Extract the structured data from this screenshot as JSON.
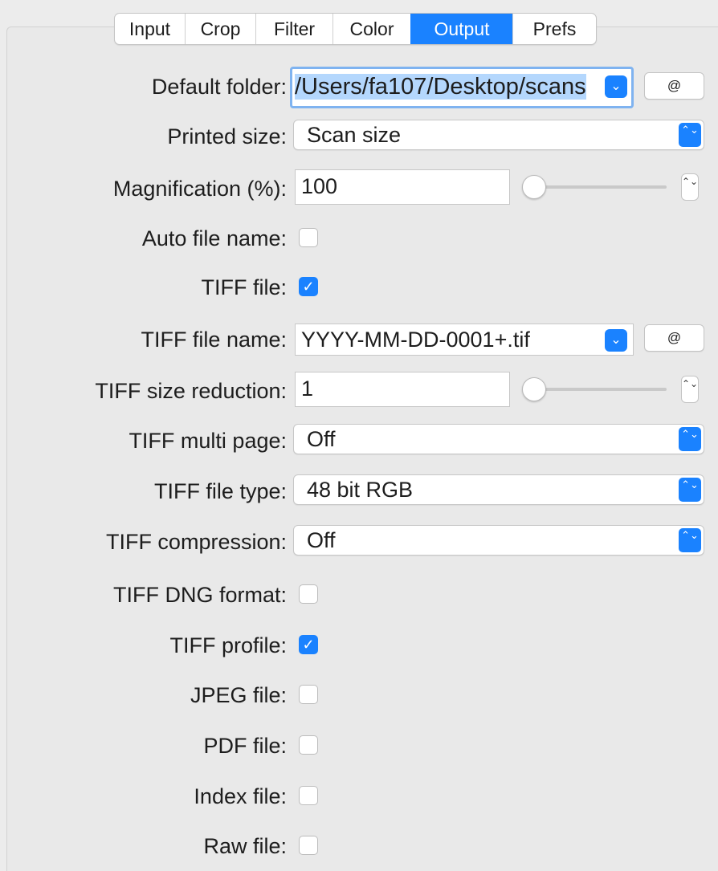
{
  "tabs": [
    {
      "label": "Input",
      "active": false
    },
    {
      "label": "Crop",
      "active": false
    },
    {
      "label": "Filter",
      "active": false
    },
    {
      "label": "Color",
      "active": false
    },
    {
      "label": "Output",
      "active": true
    },
    {
      "label": "Prefs",
      "active": false
    }
  ],
  "default_folder": {
    "label": "Default folder:",
    "value": "/Users/fa107/Desktop/scans",
    "at_label": "@"
  },
  "printed_size": {
    "label": "Printed size:",
    "value": "Scan size"
  },
  "magnification": {
    "label": "Magnification (%):",
    "value": "100"
  },
  "auto_file_name": {
    "label": "Auto file name:",
    "checked": false
  },
  "tiff_file": {
    "label": "TIFF file:",
    "checked": true
  },
  "tiff_file_name": {
    "label": "TIFF file name:",
    "value": "YYYY-MM-DD-0001+.tif",
    "at_label": "@"
  },
  "tiff_size_reduction": {
    "label": "TIFF size reduction:",
    "value": "1"
  },
  "tiff_multi_page": {
    "label": "TIFF multi page:",
    "value": "Off"
  },
  "tiff_file_type": {
    "label": "TIFF file type:",
    "value": "48 bit RGB"
  },
  "tiff_compression": {
    "label": "TIFF compression:",
    "value": "Off"
  },
  "tiff_dng_format": {
    "label": "TIFF DNG format:",
    "checked": false
  },
  "tiff_profile": {
    "label": "TIFF profile:",
    "checked": true
  },
  "jpeg_file": {
    "label": "JPEG file:",
    "checked": false
  },
  "pdf_file": {
    "label": "PDF file:",
    "checked": false
  },
  "index_file": {
    "label": "Index file:",
    "checked": false
  },
  "raw_file": {
    "label": "Raw file:",
    "checked": false
  },
  "icons": {
    "checkmark": "✓",
    "chevron_down": "⌄",
    "up_down": "⌃⌄"
  },
  "colors": {
    "accent": "#1a82ff",
    "selection": "#b4d7fd",
    "focus_ring": "#7fb3f0"
  }
}
